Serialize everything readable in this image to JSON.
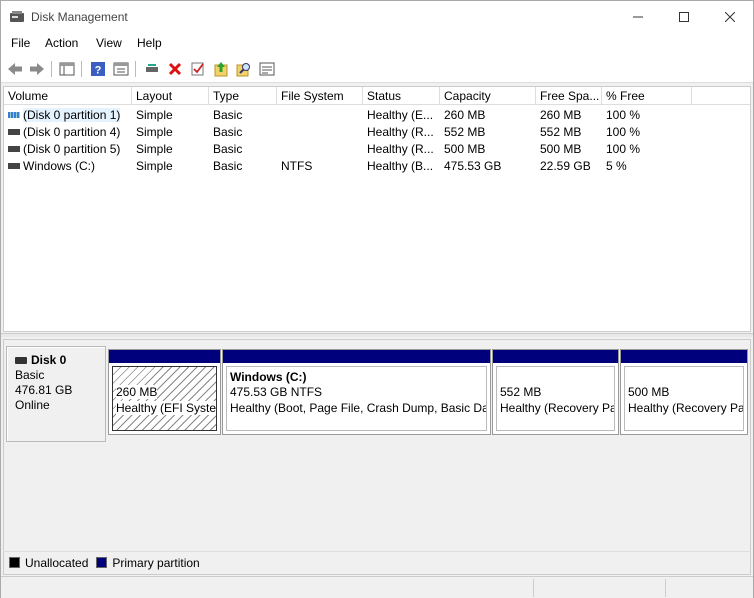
{
  "window": {
    "title": "Disk Management"
  },
  "menu": [
    "File",
    "Action",
    "View",
    "Help"
  ],
  "toolbar": {
    "icons": [
      "back-arrow-icon",
      "forward-arrow-icon",
      "show-hide-console-tree-icon",
      "help-icon",
      "properties-icon",
      "connect-disk-icon",
      "delete-icon",
      "check-icon",
      "export-icon",
      "search-icon",
      "list-icon"
    ]
  },
  "volume_list": {
    "columns": [
      "Volume",
      "Layout",
      "Type",
      "File System",
      "Status",
      "Capacity",
      "Free Spa...",
      "% Free"
    ],
    "rows": [
      {
        "volume": "(Disk 0 partition 1)",
        "layout": "Simple",
        "type": "Basic",
        "fs": "",
        "status": "Healthy (E...",
        "capacity": "260 MB",
        "free": "260 MB",
        "pct": "100 %",
        "icon_color": "#3a7bd5"
      },
      {
        "volume": "(Disk 0 partition 4)",
        "layout": "Simple",
        "type": "Basic",
        "fs": "",
        "status": "Healthy (R...",
        "capacity": "552 MB",
        "free": "552 MB",
        "pct": "100 %",
        "icon_color": "#444444"
      },
      {
        "volume": "(Disk 0 partition 5)",
        "layout": "Simple",
        "type": "Basic",
        "fs": "",
        "status": "Healthy (R...",
        "capacity": "500 MB",
        "free": "500 MB",
        "pct": "100 %",
        "icon_color": "#444444"
      },
      {
        "volume": "Windows (C:)",
        "layout": "Simple",
        "type": "Basic",
        "fs": "NTFS",
        "status": "Healthy (B...",
        "capacity": "475.53 GB",
        "free": "22.59 GB",
        "pct": "5 %",
        "icon_color": "#444444"
      }
    ]
  },
  "disk": {
    "name": "Disk 0",
    "type": "Basic",
    "size": "476.81 GB",
    "state": "Online",
    "partitions": [
      {
        "name": "",
        "size": "260 MB",
        "status": "Healthy (EFI System Partition)",
        "hatched": true
      },
      {
        "name": "Windows  (C:)",
        "size": "475.53 GB NTFS",
        "status": "Healthy (Boot, Page File, Crash Dump, Basic Data Partition)",
        "hatched": false
      },
      {
        "name": "",
        "size": "552 MB",
        "status": "Healthy (Recovery Partition)",
        "hatched": false
      },
      {
        "name": "",
        "size": "500 MB",
        "status": "Healthy (Recovery Partition)",
        "hatched": false
      }
    ]
  },
  "legend": [
    {
      "label": "Unallocated",
      "color": "#000000"
    },
    {
      "label": "Primary partition",
      "color": "#00007c"
    }
  ],
  "colors": {
    "partition_bar": "#00007c",
    "selection": "#e5f3ff"
  }
}
